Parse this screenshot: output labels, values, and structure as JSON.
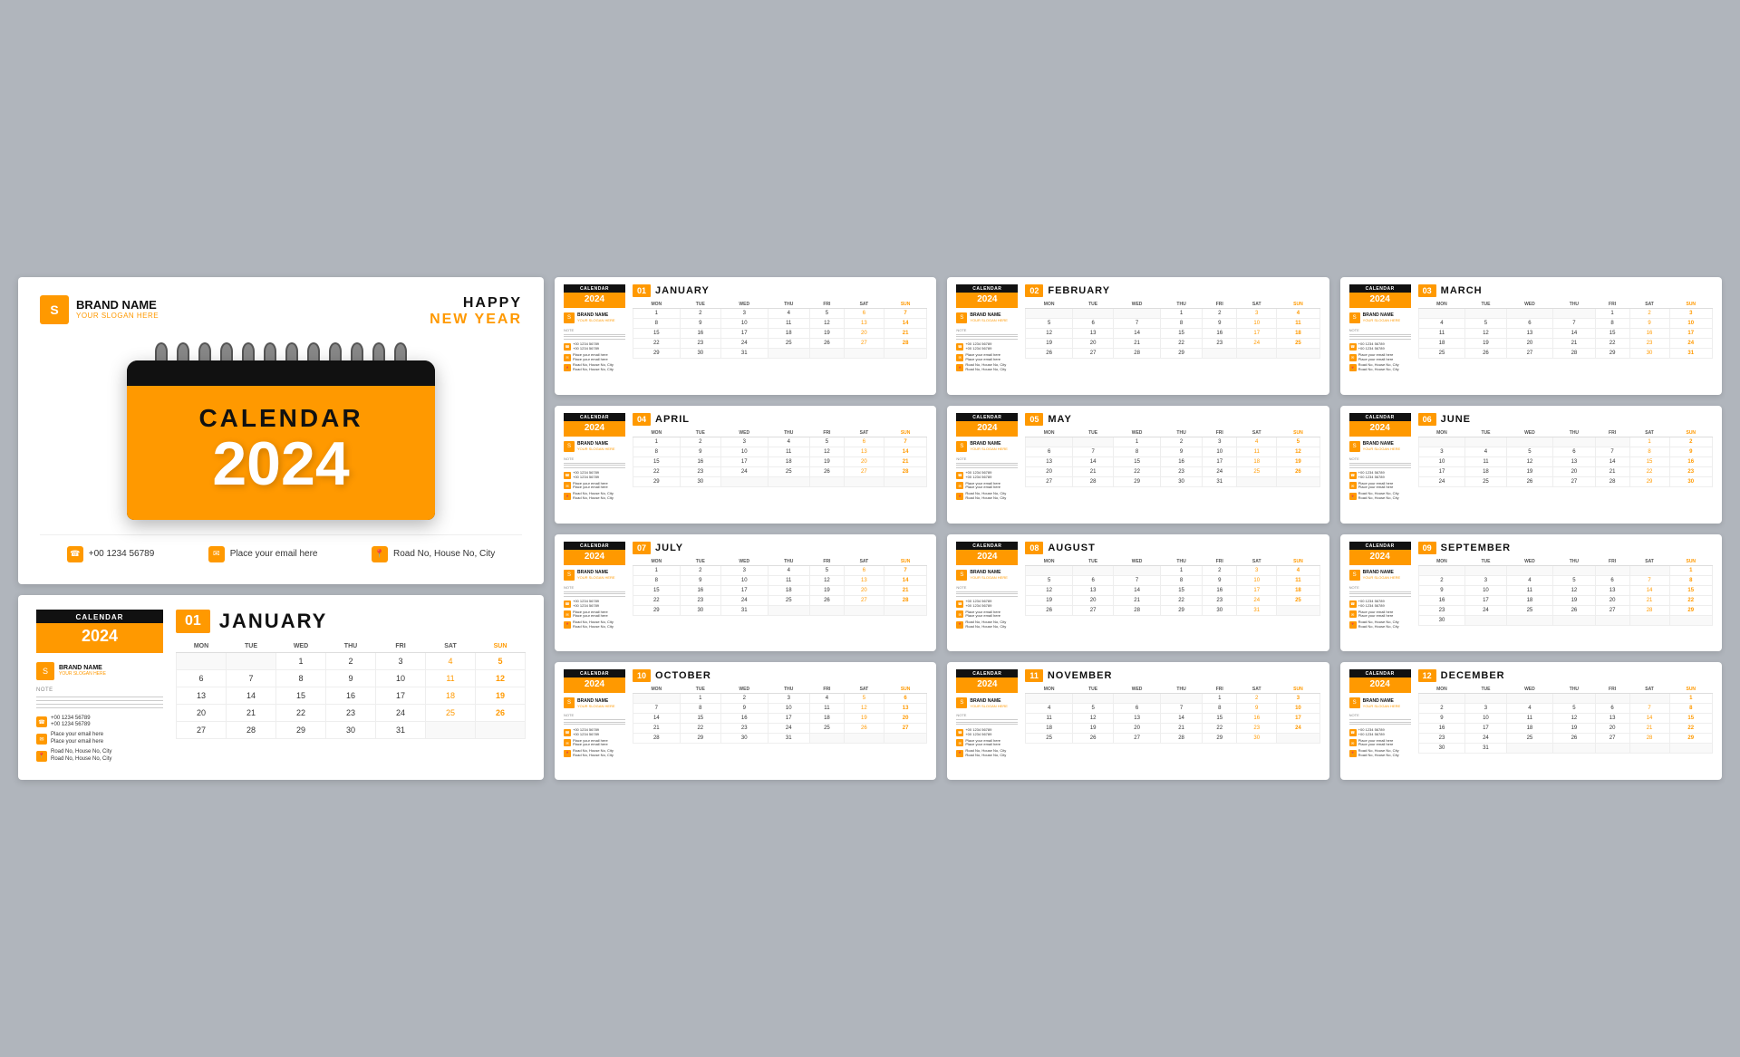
{
  "brand": {
    "name": "BRAND NAME",
    "slogan": "YOUR SLOGAN HERE",
    "icon": "S"
  },
  "cover": {
    "happy_line1": "HAPPY",
    "happy_line2": "NEW YEAR",
    "calendar_title": "CALENDAR",
    "calendar_year": "2024",
    "phone": "+00 1234 56789",
    "email": "Place your email here",
    "address": "Road No, House No, City"
  },
  "detail_page": {
    "cal_label": "CALENDAR",
    "cal_year": "2024",
    "month_num": "01",
    "month_name": "JANUARY",
    "phone1": "+00 1234 56789",
    "phone2": "+00 1234 56789",
    "email1": "Place your email here",
    "email2": "Place your email here",
    "address1": "Road No, House No, City",
    "address2": "Road No, House No, City",
    "note": "NOTE",
    "days": [
      "MON",
      "TUE",
      "WED",
      "THU",
      "FRI",
      "SAT",
      "SUN"
    ],
    "weeks": [
      [
        "",
        "",
        "1",
        "2",
        "3",
        "4",
        "5"
      ],
      [
        "6",
        "7",
        "8",
        "9",
        "10",
        "11",
        "12"
      ],
      [
        "13",
        "14",
        "15",
        "16",
        "17",
        "18",
        "19"
      ],
      [
        "20",
        "21",
        "22",
        "23",
        "24",
        "25",
        "26"
      ],
      [
        "27",
        "28",
        "29",
        "30",
        "31",
        "",
        ""
      ]
    ]
  },
  "months": [
    {
      "num": "01",
      "name": "JANUARY",
      "weeks": [
        [
          "1",
          "2",
          "3",
          "4",
          "5",
          "6",
          "7"
        ],
        [
          "8",
          "9",
          "10",
          "11",
          "12",
          "13",
          "14"
        ],
        [
          "15",
          "16",
          "17",
          "18",
          "19",
          "20",
          "21"
        ],
        [
          "22",
          "23",
          "24",
          "25",
          "26",
          "27",
          "28"
        ],
        [
          "29",
          "30",
          "31",
          "",
          "",
          "",
          ""
        ]
      ]
    },
    {
      "num": "02",
      "name": "FEBRUARY",
      "weeks": [
        [
          "",
          "",
          "",
          "1",
          "2",
          "3",
          "4"
        ],
        [
          "5",
          "6",
          "7",
          "8",
          "9",
          "10",
          "11"
        ],
        [
          "12",
          "13",
          "14",
          "15",
          "16",
          "17",
          "18"
        ],
        [
          "19",
          "20",
          "21",
          "22",
          "23",
          "24",
          "25"
        ],
        [
          "26",
          "27",
          "28",
          "29",
          "",
          "",
          ""
        ]
      ]
    },
    {
      "num": "03",
      "name": "MARCH",
      "weeks": [
        [
          "",
          "",
          "",
          "",
          "1",
          "2",
          "3"
        ],
        [
          "4",
          "5",
          "6",
          "7",
          "8",
          "9",
          "10"
        ],
        [
          "11",
          "12",
          "13",
          "14",
          "15",
          "16",
          "17"
        ],
        [
          "18",
          "19",
          "20",
          "21",
          "22",
          "23",
          "24"
        ],
        [
          "25",
          "26",
          "27",
          "28",
          "29",
          "30",
          "31"
        ]
      ]
    },
    {
      "num": "04",
      "name": "APRIL",
      "weeks": [
        [
          "1",
          "2",
          "3",
          "4",
          "5",
          "6",
          "7"
        ],
        [
          "8",
          "9",
          "10",
          "11",
          "12",
          "13",
          "14"
        ],
        [
          "15",
          "16",
          "17",
          "18",
          "19",
          "20",
          "21"
        ],
        [
          "22",
          "23",
          "24",
          "25",
          "26",
          "27",
          "28"
        ],
        [
          "29",
          "30",
          "",
          "",
          "",
          "",
          ""
        ]
      ]
    },
    {
      "num": "05",
      "name": "MAY",
      "weeks": [
        [
          "",
          "",
          "1",
          "2",
          "3",
          "4",
          "5"
        ],
        [
          "6",
          "7",
          "8",
          "9",
          "10",
          "11",
          "12"
        ],
        [
          "13",
          "14",
          "15",
          "16",
          "17",
          "18",
          "19"
        ],
        [
          "20",
          "21",
          "22",
          "23",
          "24",
          "25",
          "26"
        ],
        [
          "27",
          "28",
          "29",
          "30",
          "31",
          "",
          ""
        ]
      ]
    },
    {
      "num": "06",
      "name": "JUNE",
      "weeks": [
        [
          "",
          "",
          "",
          "",
          "",
          "1",
          "2"
        ],
        [
          "3",
          "4",
          "5",
          "6",
          "7",
          "8",
          "9"
        ],
        [
          "10",
          "11",
          "12",
          "13",
          "14",
          "15",
          "16"
        ],
        [
          "17",
          "18",
          "19",
          "20",
          "21",
          "22",
          "23"
        ],
        [
          "24",
          "25",
          "26",
          "27",
          "28",
          "29",
          "30"
        ]
      ]
    },
    {
      "num": "07",
      "name": "JULY",
      "weeks": [
        [
          "1",
          "2",
          "3",
          "4",
          "5",
          "6",
          "7"
        ],
        [
          "8",
          "9",
          "10",
          "11",
          "12",
          "13",
          "14"
        ],
        [
          "15",
          "16",
          "17",
          "18",
          "19",
          "20",
          "21"
        ],
        [
          "22",
          "23",
          "24",
          "25",
          "26",
          "27",
          "28"
        ],
        [
          "29",
          "30",
          "31",
          "",
          "",
          "",
          ""
        ]
      ]
    },
    {
      "num": "08",
      "name": "AUGUST",
      "weeks": [
        [
          "",
          "",
          "",
          "1",
          "2",
          "3",
          "4"
        ],
        [
          "5",
          "6",
          "7",
          "8",
          "9",
          "10",
          "11"
        ],
        [
          "12",
          "13",
          "14",
          "15",
          "16",
          "17",
          "18"
        ],
        [
          "19",
          "20",
          "21",
          "22",
          "23",
          "24",
          "25"
        ],
        [
          "26",
          "27",
          "28",
          "29",
          "30",
          "31",
          ""
        ]
      ]
    },
    {
      "num": "09",
      "name": "SEPTEMBER",
      "weeks": [
        [
          "",
          "",
          "",
          "",
          "",
          "",
          "1"
        ],
        [
          "2",
          "3",
          "4",
          "5",
          "6",
          "7",
          "8"
        ],
        [
          "9",
          "10",
          "11",
          "12",
          "13",
          "14",
          "15"
        ],
        [
          "16",
          "17",
          "18",
          "19",
          "20",
          "21",
          "22"
        ],
        [
          "23",
          "24",
          "25",
          "26",
          "27",
          "28",
          "29"
        ],
        [
          "30",
          "",
          "",
          "",
          "",
          "",
          ""
        ]
      ]
    },
    {
      "num": "10",
      "name": "OCTOBER",
      "weeks": [
        [
          "",
          "1",
          "2",
          "3",
          "4",
          "5",
          "6"
        ],
        [
          "7",
          "8",
          "9",
          "10",
          "11",
          "12",
          "13"
        ],
        [
          "14",
          "15",
          "16",
          "17",
          "18",
          "19",
          "20"
        ],
        [
          "21",
          "22",
          "23",
          "24",
          "25",
          "26",
          "27"
        ],
        [
          "28",
          "29",
          "30",
          "31",
          "",
          "",
          ""
        ]
      ]
    },
    {
      "num": "11",
      "name": "NOVEMBER",
      "weeks": [
        [
          "",
          "",
          "",
          "",
          "1",
          "2",
          "3"
        ],
        [
          "4",
          "5",
          "6",
          "7",
          "8",
          "9",
          "10"
        ],
        [
          "11",
          "12",
          "13",
          "14",
          "15",
          "16",
          "17"
        ],
        [
          "18",
          "19",
          "20",
          "21",
          "22",
          "23",
          "24"
        ],
        [
          "25",
          "26",
          "27",
          "28",
          "29",
          "30",
          ""
        ]
      ]
    },
    {
      "num": "12",
      "name": "DECEMBER",
      "weeks": [
        [
          "",
          "",
          "",
          "",
          "",
          "",
          "1"
        ],
        [
          "2",
          "3",
          "4",
          "5",
          "6",
          "7",
          "8"
        ],
        [
          "9",
          "10",
          "11",
          "12",
          "13",
          "14",
          "15"
        ],
        [
          "16",
          "17",
          "18",
          "19",
          "20",
          "21",
          "22"
        ],
        [
          "23",
          "24",
          "25",
          "26",
          "27",
          "28",
          "29"
        ],
        [
          "30",
          "31",
          "",
          "",
          "",
          "",
          ""
        ]
      ]
    }
  ]
}
